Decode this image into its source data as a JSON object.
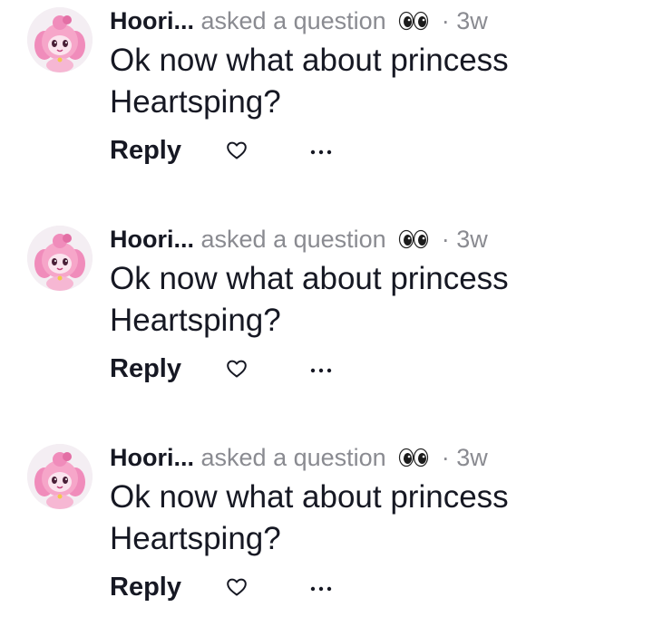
{
  "colors": {
    "text_primary": "#161823",
    "text_secondary": "#8a8b91",
    "avatar_pink": "#f29ac2"
  },
  "comments": [
    {
      "username": "Hoori...",
      "action": "asked a question",
      "action_icon": "eyes-emoji-icon",
      "separator": "·",
      "time": "3w",
      "text": "Ok now what about princess Heartsping?",
      "reply_label": "Reply",
      "like_icon": "heart-outline-icon",
      "more_icon": "more-dots-icon"
    },
    {
      "username": "Hoori...",
      "action": "asked a question",
      "action_icon": "eyes-emoji-icon",
      "separator": "·",
      "time": "3w",
      "text": "Ok now what about princess Heartsping?",
      "reply_label": "Reply",
      "like_icon": "heart-outline-icon",
      "more_icon": "more-dots-icon"
    },
    {
      "username": "Hoori...",
      "action": "asked a question",
      "action_icon": "eyes-emoji-icon",
      "separator": "·",
      "time": "3w",
      "text": "Ok now what about princess Heartsping?",
      "reply_label": "Reply",
      "like_icon": "heart-outline-icon",
      "more_icon": "more-dots-icon"
    }
  ]
}
